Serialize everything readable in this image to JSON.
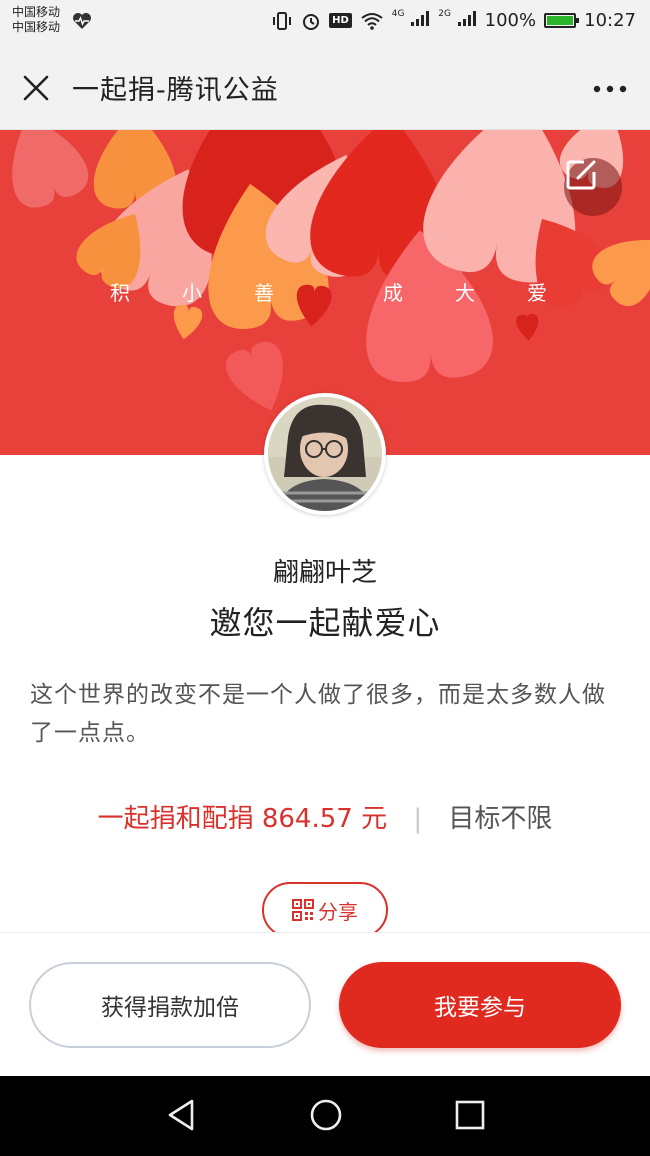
{
  "status_bar": {
    "carrier_1": "中国移动",
    "carrier_2": "中国移动",
    "network_1": "4G",
    "network_2": "2G",
    "battery": "100%",
    "time": "10:27"
  },
  "nav": {
    "title": "一起捐-腾讯公益",
    "close_icon": "close-icon",
    "more_icon": "more-icon"
  },
  "banner": {
    "slogan_chars": [
      "积",
      "小",
      "善",
      "成",
      "大",
      "爱"
    ],
    "edit_icon": "edit-icon"
  },
  "profile": {
    "name": "翩翩叶芝",
    "invite_text": "邀您一起献爱心",
    "description": "这个世界的改变不是一个人做了很多，而是太多数人做了一点点。"
  },
  "stats": {
    "raised_text": "一起捐和配捐 864.57 元",
    "separator": "|",
    "target_text": "目标不限"
  },
  "share": {
    "label": "分享",
    "icon": "qrcode-icon"
  },
  "actions": {
    "double_label": "获得捐款加倍",
    "join_label": "我要参与"
  },
  "colors": {
    "accent": "#e0291f",
    "banner": "#e8403a"
  }
}
